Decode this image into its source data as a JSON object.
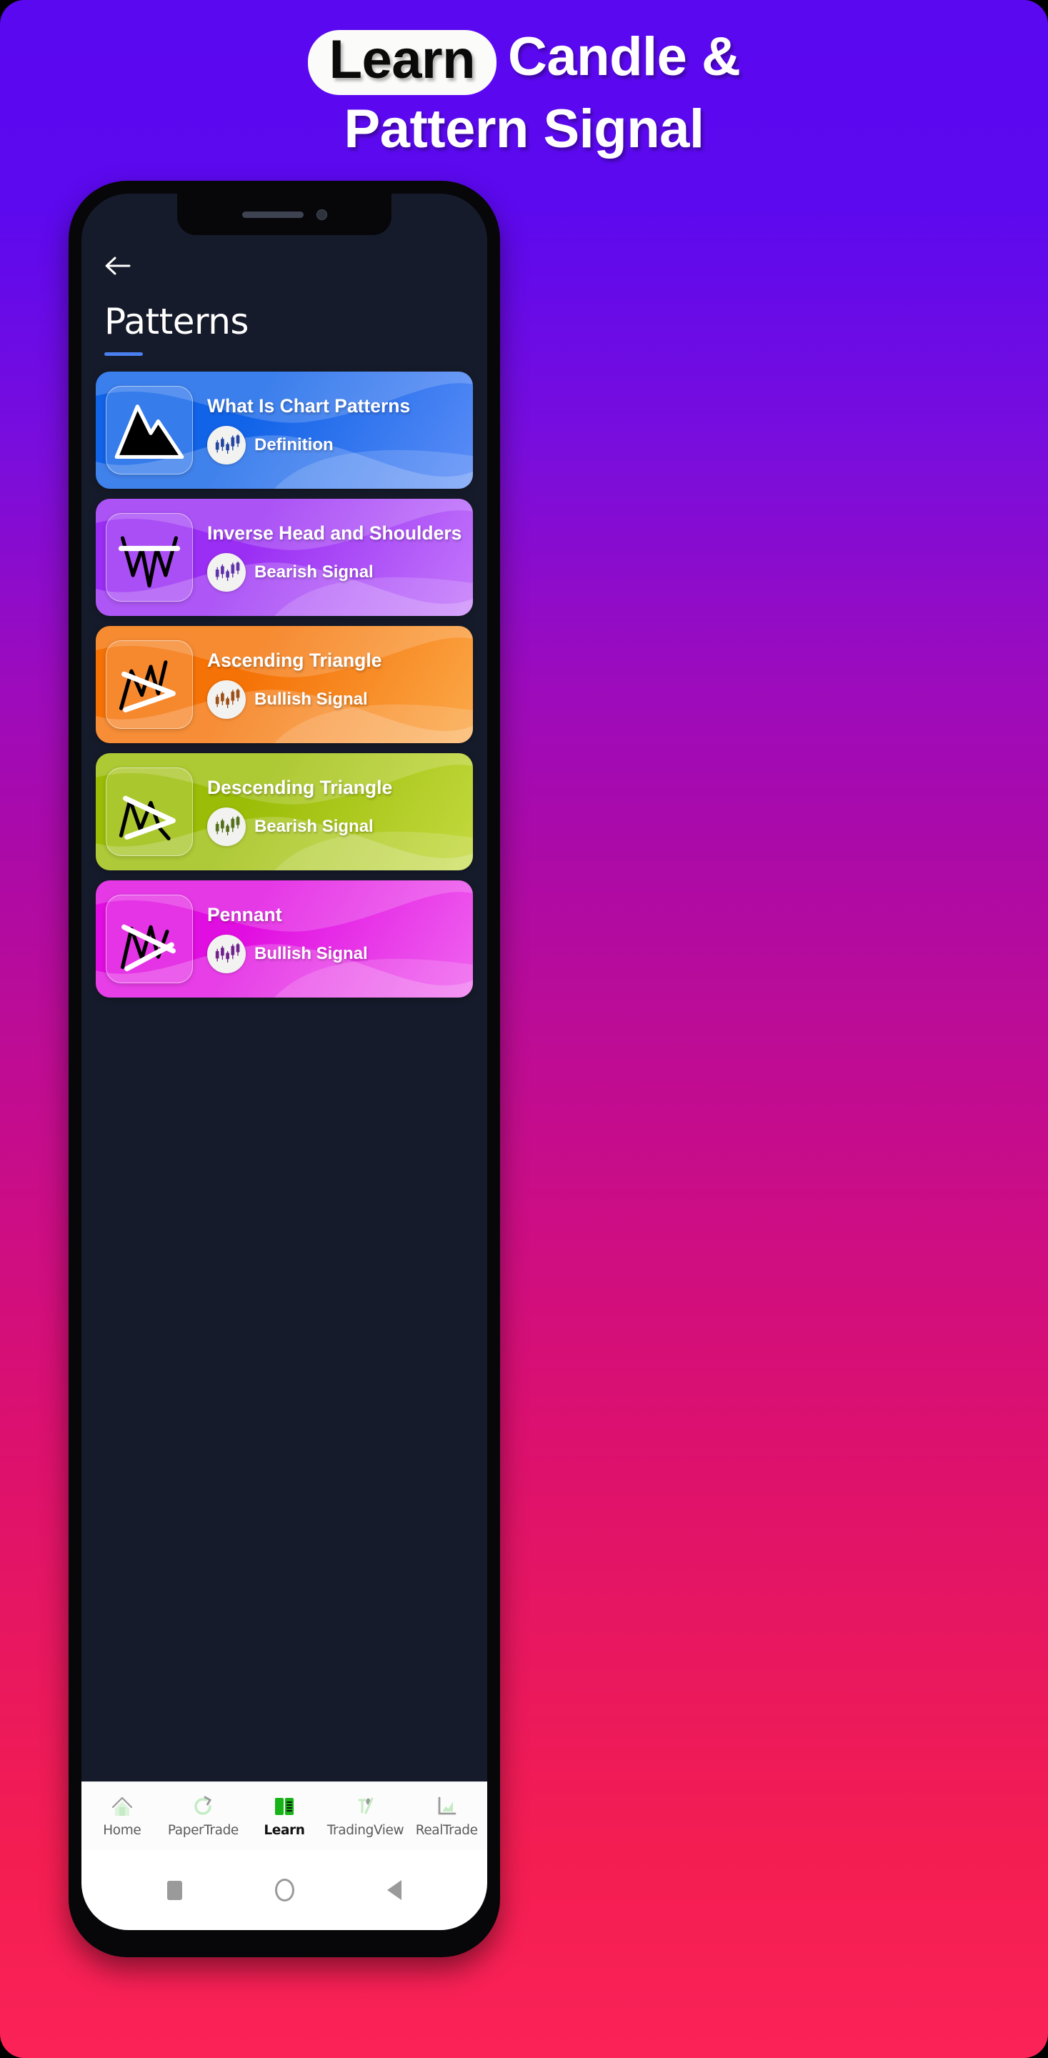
{
  "poster": {
    "headline_line1_badge": "Learn",
    "headline_line1_rest": "Candle &",
    "headline_line2": "Pattern Signal",
    "bg_gradient_start": "#5a08f0",
    "bg_gradient_mid": "#bc0c96",
    "bg_gradient_end": "#fa2257"
  },
  "app": {
    "back_icon": "arrow-left-icon",
    "page_title": "Patterns",
    "title_accent_color": "#4a7ff0",
    "screen_bg": "#161b2b"
  },
  "cards": [
    {
      "title": "What Is Chart Patterns",
      "signal": "Definition",
      "icon": "mountain-peaks-icon",
      "color_from": "#1163e8",
      "color_to": "#5b8df7",
      "badge_candle_color": "#1d3f9e"
    },
    {
      "title": "Inverse Head and Shoulders",
      "signal": "Bearish Signal",
      "icon": "inverse-head-shoulders-icon",
      "color_from": "#9a2ef4",
      "color_to": "#c377fb",
      "badge_candle_color": "#5b2aa8"
    },
    {
      "title": "Ascending Triangle",
      "signal": "Bullish Signal",
      "icon": "ascending-triangle-icon",
      "color_from": "#f57206",
      "color_to": "#fba94a",
      "badge_candle_color": "#9a4a10"
    },
    {
      "title": "Descending Triangle",
      "signal": "Bearish Signal",
      "icon": "descending-triangle-icon",
      "color_from": "#9bbd07",
      "color_to": "#c4d93f",
      "badge_candle_color": "#4e6b12"
    },
    {
      "title": "Pennant",
      "signal": "Bullish Signal",
      "icon": "pennant-icon",
      "color_from": "#e10ee1",
      "color_to": "#ef63ef",
      "badge_candle_color": "#6b1a8a"
    }
  ],
  "bottom_nav": {
    "items": [
      {
        "label": "Home",
        "icon": "home-icon",
        "active": false
      },
      {
        "label": "PaperTrade",
        "icon": "refresh-icon",
        "active": false
      },
      {
        "label": "Learn",
        "icon": "open-book-icon",
        "active": true
      },
      {
        "label": "TradingView",
        "icon": "candle-icon",
        "active": false
      },
      {
        "label": "RealTrade",
        "icon": "area-chart-icon",
        "active": false
      }
    ],
    "active_icon_color": "#17b317",
    "inactive_icon_color": "#c4ebc4"
  },
  "system_bar": {
    "recents": "square-icon",
    "home": "circle-icon",
    "back": "triangle-back-icon"
  }
}
